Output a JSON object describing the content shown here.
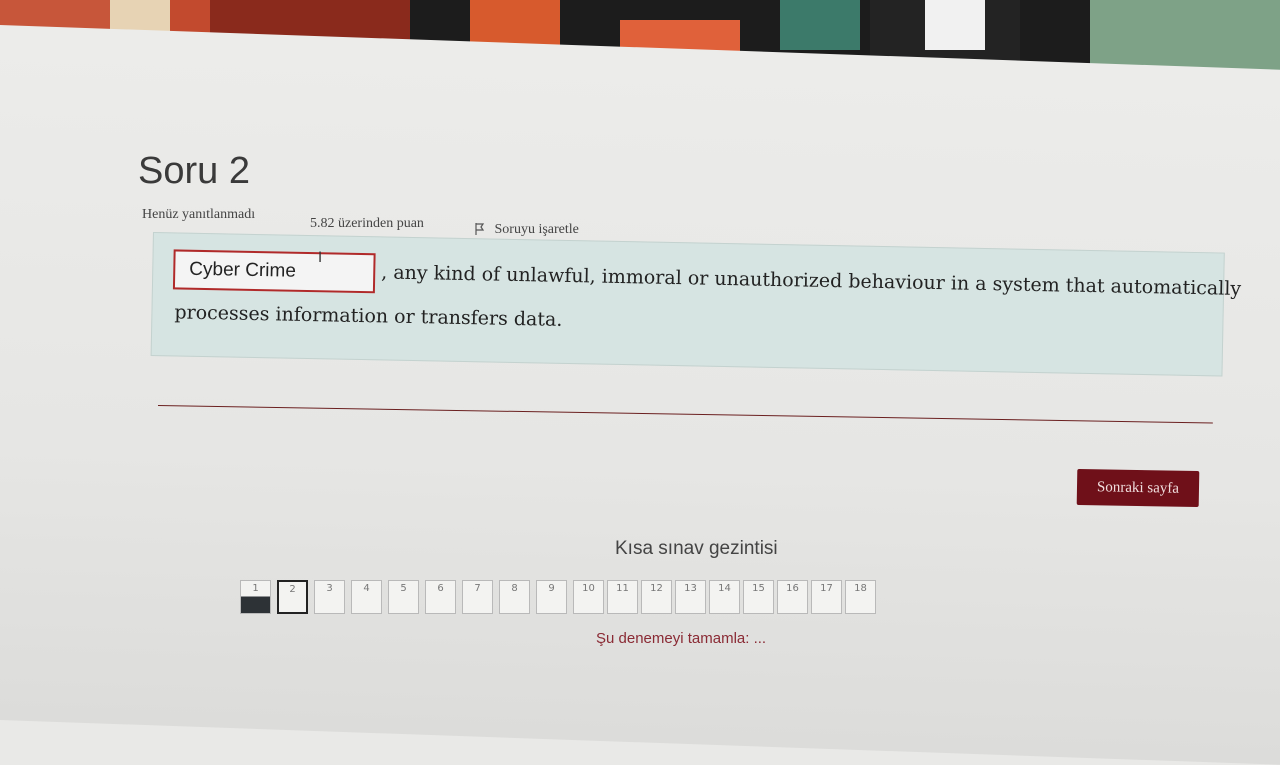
{
  "question": {
    "title": "Soru 2",
    "status": "Henüz yanıtlanmadı",
    "points": "5.82 üzerinden puan",
    "flag_label": "Soruyu işaretle",
    "answer_value": "Cyber Crime",
    "text_line1": ", any kind of unlawful, immoral or unauthorized behaviour in a system that automatically",
    "text_line2": "processes information or transfers data."
  },
  "next_button": "Sonraki sayfa",
  "nav": {
    "title": "Kısa sınav gezintisi",
    "buttons": [
      "1",
      "2",
      "3",
      "4",
      "5",
      "6",
      "7",
      "8",
      "9",
      "10",
      "11",
      "12",
      "13",
      "14",
      "15",
      "16",
      "17",
      "18"
    ],
    "answered": "1",
    "current": "2",
    "finish_link": "Şu denemeyi tamamla: ..."
  },
  "colors": {
    "accent": "#6f1019",
    "question_bg": "#d6e4e2",
    "input_border": "#b02a2a"
  }
}
